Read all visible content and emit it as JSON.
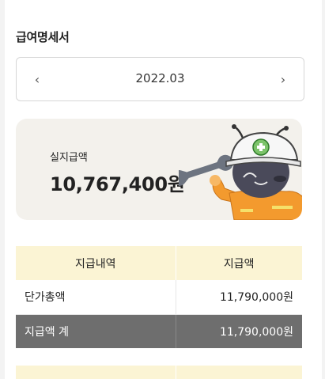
{
  "header": {
    "title": "급여명세서"
  },
  "month_nav": {
    "prev_icon": "chevron-left-icon",
    "next_icon": "chevron-right-icon",
    "current": "2022.03",
    "prev_glyph": "‹",
    "next_glyph": "›"
  },
  "net_pay": {
    "label": "실지급액",
    "value": "10,767,400원"
  },
  "mascot": {
    "icon": "worker-mascot-icon"
  },
  "table": {
    "headers": [
      "지급내역",
      "지급액"
    ],
    "rows": [
      {
        "name": "단가총액",
        "amount": "11,790,000원"
      }
    ],
    "total": {
      "name": "지급액 계",
      "amount": "11,790,000원"
    }
  },
  "colors": {
    "header_bg": "#fbf4d4",
    "card_bg": "#f3f1ec",
    "total_row_bg": "#6e6e6e",
    "mascot_body": "#f39a2e",
    "mascot_face": "#4a4a5a"
  }
}
